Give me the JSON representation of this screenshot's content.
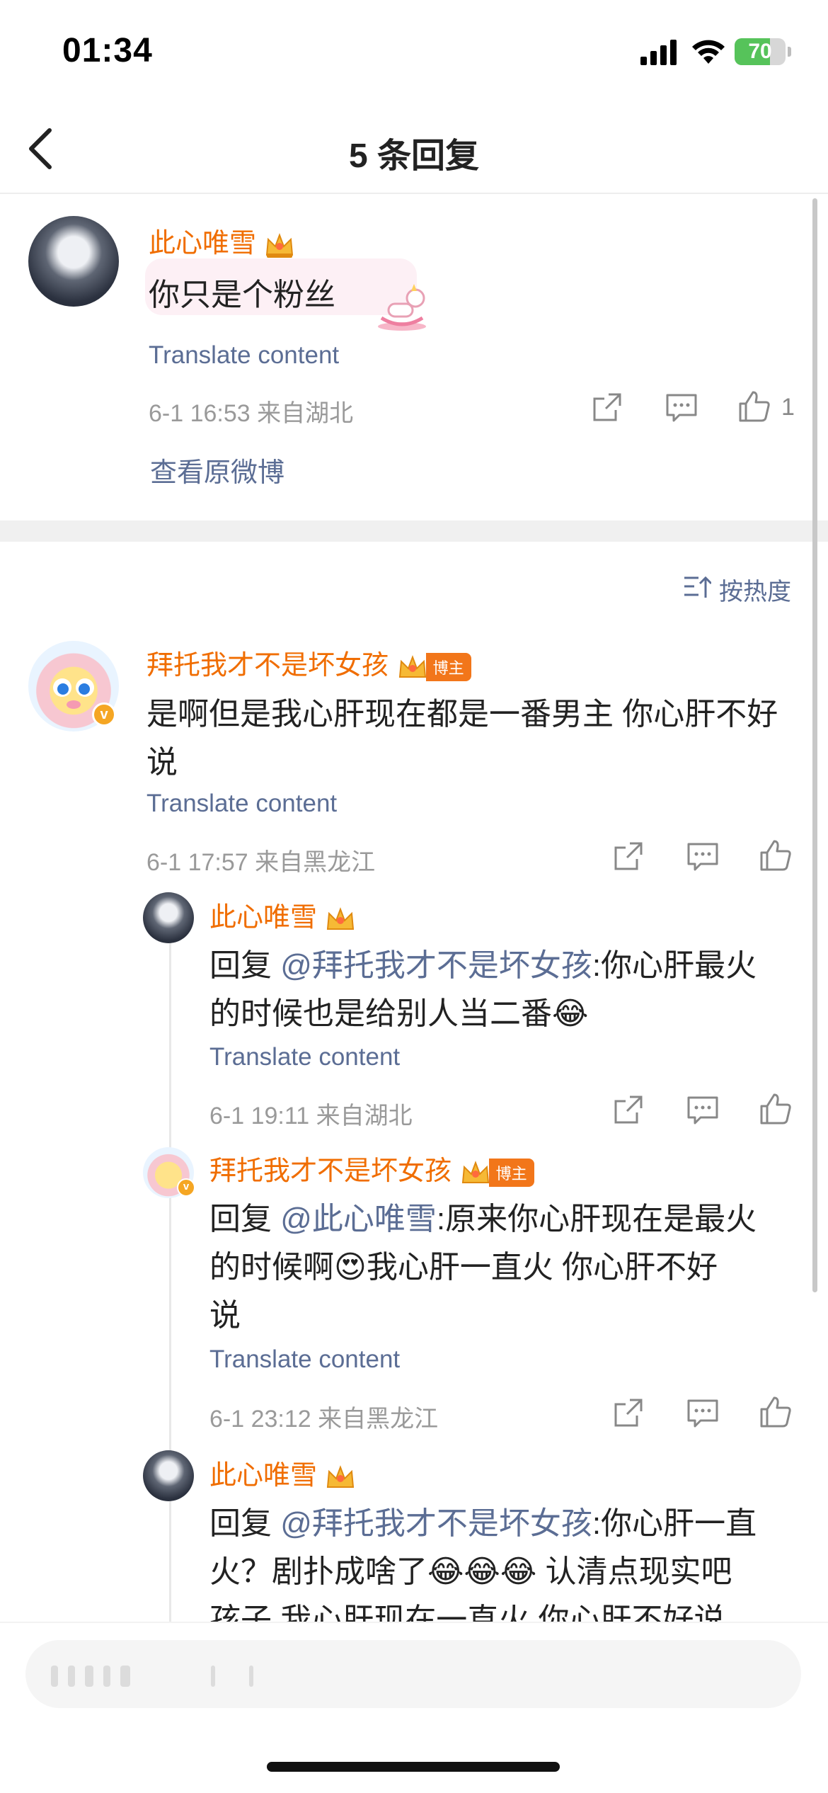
{
  "status_bar": {
    "time": "01:34",
    "battery_percent": 70,
    "battery_label": "70"
  },
  "nav": {
    "title": "5 条回复"
  },
  "main_comment": {
    "author": "此心唯雪",
    "text": "你只是个粉丝",
    "translate": "Translate content",
    "meta": "6-1 16:53  来自湖北",
    "like_count": "1",
    "view_original": "查看原微博"
  },
  "sort": {
    "label": "按热度"
  },
  "replies": [
    {
      "author": "拜托我才不是坏女孩",
      "badge": "博主",
      "text": "是啊但是我心肝现在都是一番男主 你心肝不好说",
      "translate": "Translate content",
      "meta": "6-1 17:57  来自黑龙江"
    },
    {
      "author": "此心唯雪",
      "reply_prefix": "回复 ",
      "mention": "@拜托我才不是坏女孩",
      "text_line1": ":你心肝最火",
      "text_line2": "的时候也是给别人当二番",
      "emoji": "😂",
      "translate": "Translate content",
      "meta": "6-1 19:11  来自湖北"
    },
    {
      "author": "拜托我才不是坏女孩",
      "badge": "博主",
      "reply_prefix": "回复 ",
      "mention": "@此心唯雪",
      "text_line1": ":原来你心肝现在是最火",
      "text_line2a": "的时候啊",
      "emoji": "😍",
      "text_line2b": "我心肝一直火 你心肝不好",
      "text_line3": "说",
      "translate": "Translate content",
      "meta": "6-1 23:12  来自黑龙江"
    },
    {
      "author": "此心唯雪",
      "reply_prefix": "回复 ",
      "mention": "@拜托我才不是坏女孩",
      "text_line1": ":你心肝一直",
      "text_line2a": "火？剧扑成啥了",
      "emojis": "😂😂😂",
      "text_line2b": " 认清点现实吧",
      "text_line3": "孩子 我心肝现在一直火 你心肝不好说"
    }
  ],
  "icons": {
    "back": "chevron-left-icon",
    "share": "share-icon",
    "comment": "comment-icon",
    "like": "thumbs-up-icon",
    "crown": "crown-icon",
    "sort": "sort-icon"
  },
  "colors": {
    "username": "#f06d00",
    "link": "#5b6d94",
    "meta": "#9a9a9a",
    "battery": "#56c35a"
  }
}
